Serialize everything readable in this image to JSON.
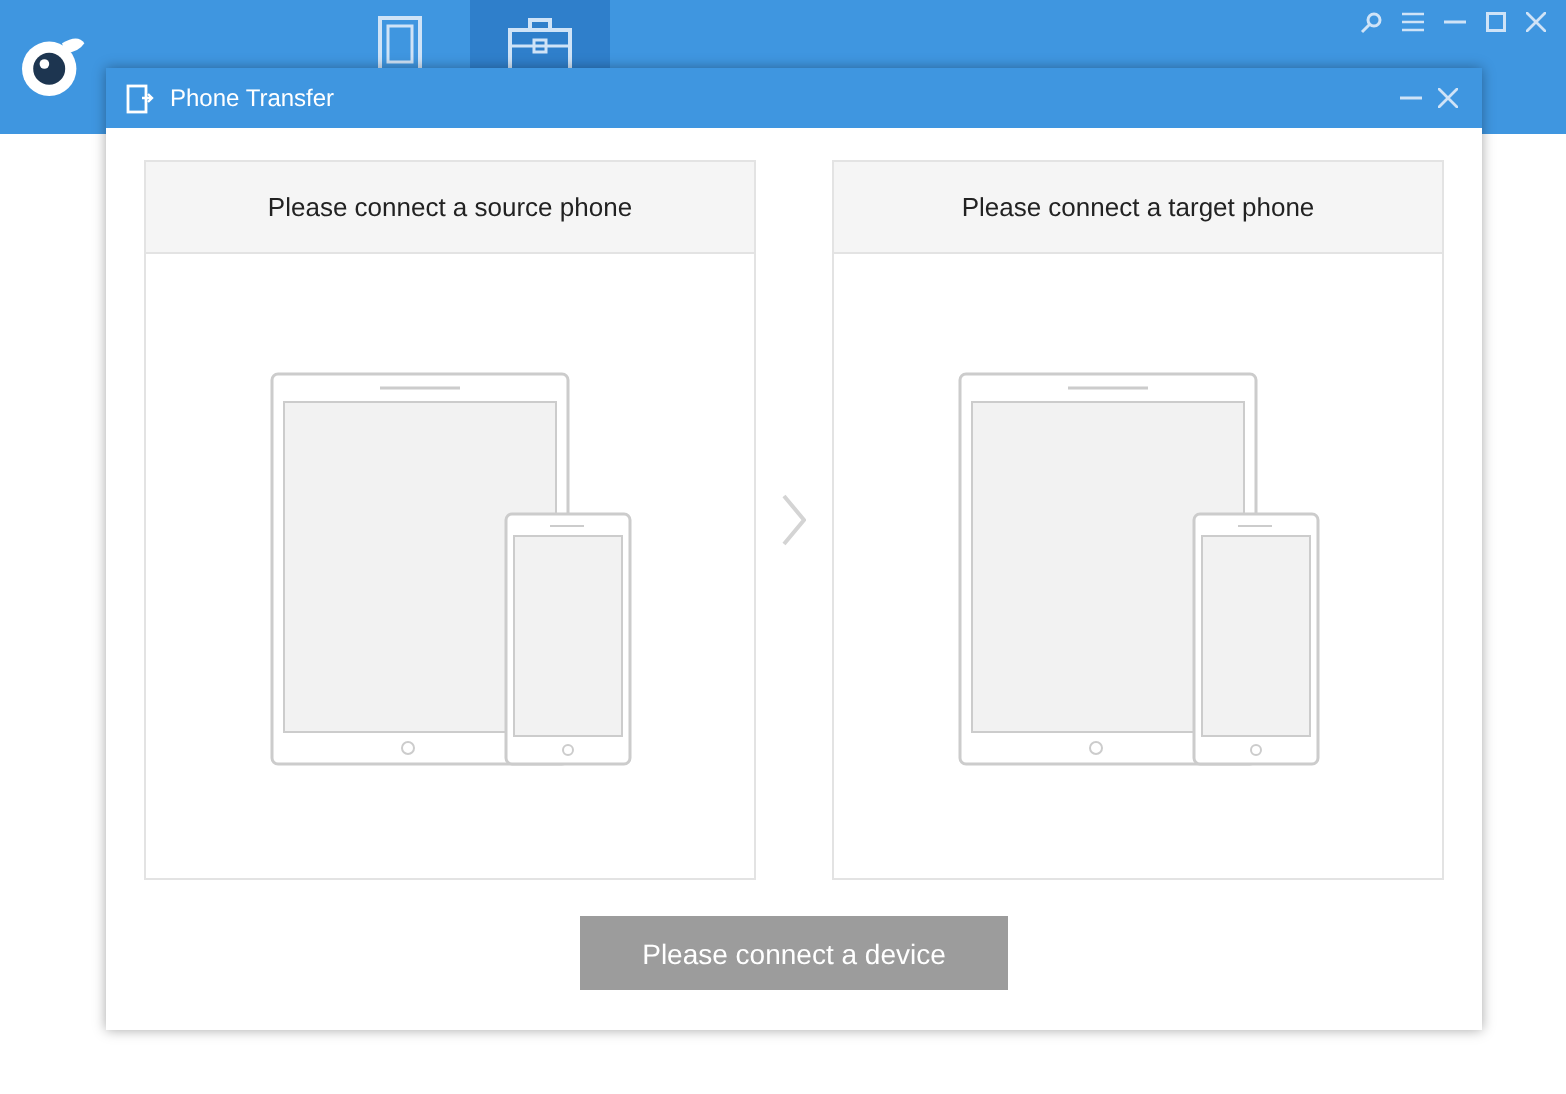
{
  "app_tabs": [
    {
      "selected": false
    },
    {
      "selected": true
    }
  ],
  "dialog": {
    "title": "Phone Transfer",
    "panels": [
      {
        "heading": "Please connect a source phone"
      },
      {
        "heading": "Please connect a target phone"
      }
    ],
    "button": {
      "label": "Please connect a device",
      "disabled": true
    }
  }
}
